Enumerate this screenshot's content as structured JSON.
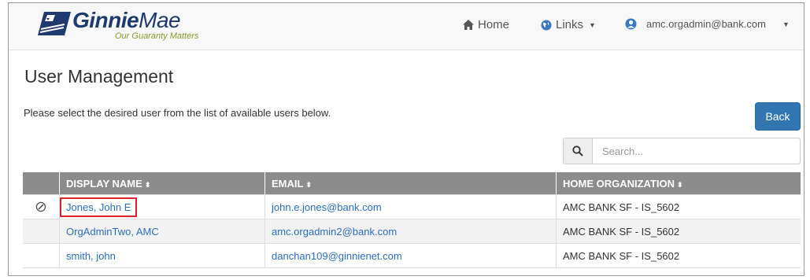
{
  "brand": {
    "name_bold": "Ginnie",
    "name_light": "Mae",
    "tagline": "Our Guaranty Matters",
    "colors": {
      "navy": "#1e3a6e",
      "olive": "#8a9a2a"
    }
  },
  "nav": {
    "home_label": "Home",
    "links_label": "Links",
    "user_email": "amc.orgadmin@bank.com",
    "icons": {
      "home": "home-icon",
      "links": "globe-icon",
      "user": "user-circle-icon"
    }
  },
  "page": {
    "title": "User Management",
    "instructions": "Please select the desired user from the list of available users below.",
    "back_label": "Back"
  },
  "search": {
    "placeholder": "Search...",
    "value": ""
  },
  "table": {
    "columns": [
      "DISPLAY NAME",
      "EMAIL",
      "HOME ORGANIZATION"
    ],
    "sort_glyph": "⬍",
    "rows": [
      {
        "status_icon": "blocked-icon",
        "status_glyph": "⊘",
        "display_name": "Jones, John E",
        "email": "john.e.jones@bank.com",
        "home_org": "AMC BANK SF - IS_5602",
        "highlighted": true
      },
      {
        "status_icon": "",
        "status_glyph": "",
        "display_name": "OrgAdminTwo, AMC",
        "email": "amc.orgadmin2@bank.com",
        "home_org": "AMC BANK SF - IS_5602",
        "highlighted": false
      },
      {
        "status_icon": "",
        "status_glyph": "",
        "display_name": "smith, john",
        "email": "danchan109@ginnienet.com",
        "home_org": "AMC BANK SF - IS_5602",
        "highlighted": false
      }
    ]
  },
  "colors": {
    "accent": "#3276b1",
    "link": "#2a6ebb",
    "table_header": "#8c8c8c",
    "highlight_box": "#d9242b"
  }
}
